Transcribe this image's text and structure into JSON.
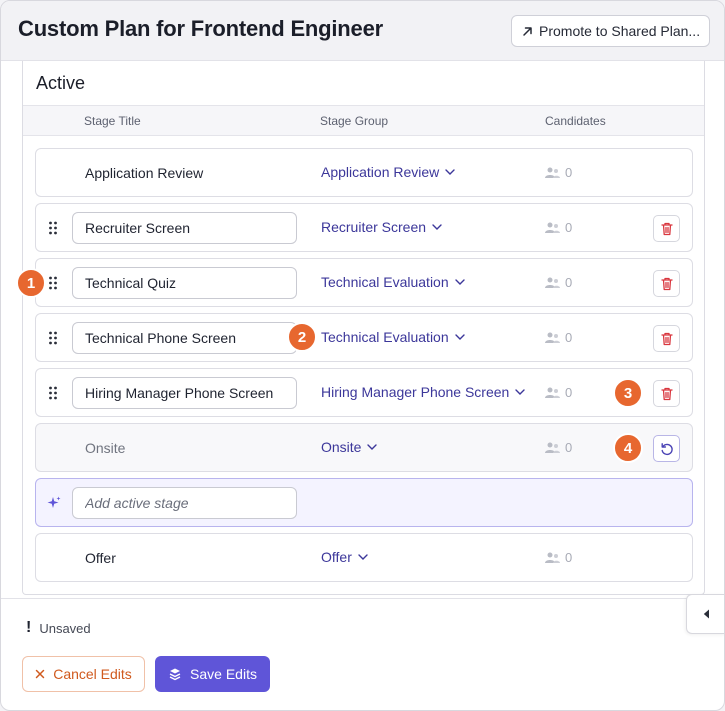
{
  "header": {
    "title": "Custom Plan for Frontend Engineer",
    "promote_label": "Promote to Shared Plan..."
  },
  "section": {
    "title": "Active",
    "columns": [
      "Stage Title",
      "Stage Group",
      "Candidates"
    ]
  },
  "stages": [
    {
      "title": "Application Review",
      "group": "Application Review",
      "candidates": "0",
      "editable": false
    },
    {
      "title": "Recruiter Screen",
      "group": "Recruiter Screen",
      "candidates": "0",
      "editable": true,
      "action": "delete"
    },
    {
      "title": "Technical Quiz",
      "group": "Technical Evaluation",
      "candidates": "0",
      "editable": true,
      "action": "delete"
    },
    {
      "title": "Technical Phone Screen",
      "group": "Technical Evaluation",
      "candidates": "0",
      "editable": true,
      "action": "delete"
    },
    {
      "title": "Hiring Manager Phone Screen",
      "group": "Hiring Manager Phone Screen",
      "candidates": "0",
      "editable": true,
      "action": "delete"
    },
    {
      "title": "Onsite",
      "group": "Onsite",
      "candidates": "0",
      "editable": false,
      "removed": true,
      "action": "undo"
    },
    {
      "title": "Offer",
      "group": "Offer",
      "candidates": "0",
      "editable": false
    }
  ],
  "add_stage": {
    "placeholder": "Add active stage"
  },
  "annotations": [
    "1",
    "2",
    "3",
    "4"
  ],
  "footer": {
    "status": "Unsaved",
    "cancel_label": "Cancel Edits",
    "save_label": "Save Edits"
  },
  "colors": {
    "accent": "#5f55d8",
    "group_link": "#3c379a",
    "danger": "#d9363e",
    "badge": "#e7672f",
    "cancel": "#d05a1e"
  }
}
